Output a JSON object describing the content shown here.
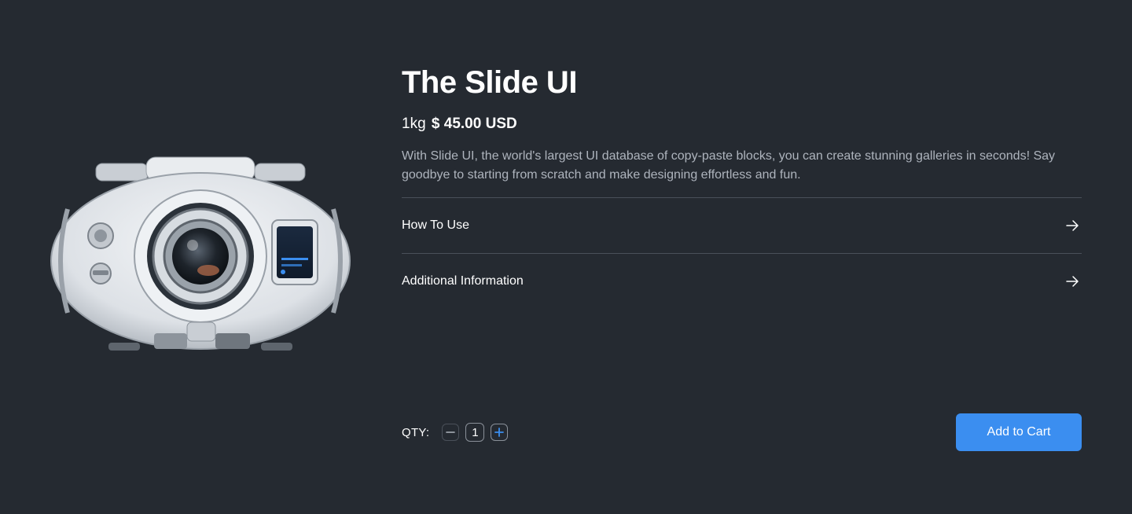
{
  "product": {
    "title": "The Slide UI",
    "weight": "1kg",
    "price": "$ 45.00 USD",
    "description": "With Slide UI, the world's largest UI database of copy-paste blocks, you can create stunning galleries in seconds! Say goodbye to starting from scratch and make designing effortless and fun.",
    "image_icon": "camera-robot-image"
  },
  "accordion": {
    "items": [
      {
        "label": "How To Use",
        "icon": "arrow-right-icon"
      },
      {
        "label": "Additional Information",
        "icon": "arrow-right-icon"
      }
    ]
  },
  "quantity": {
    "label": "QTY:",
    "value": "1",
    "decrement_icon": "minus-icon",
    "increment_icon": "plus-icon"
  },
  "cart": {
    "button_label": "Add to Cart"
  },
  "colors": {
    "background": "#252a31",
    "accent": "#3b8ef0",
    "divider": "#4a5059",
    "muted_text": "#aeb4bd"
  }
}
